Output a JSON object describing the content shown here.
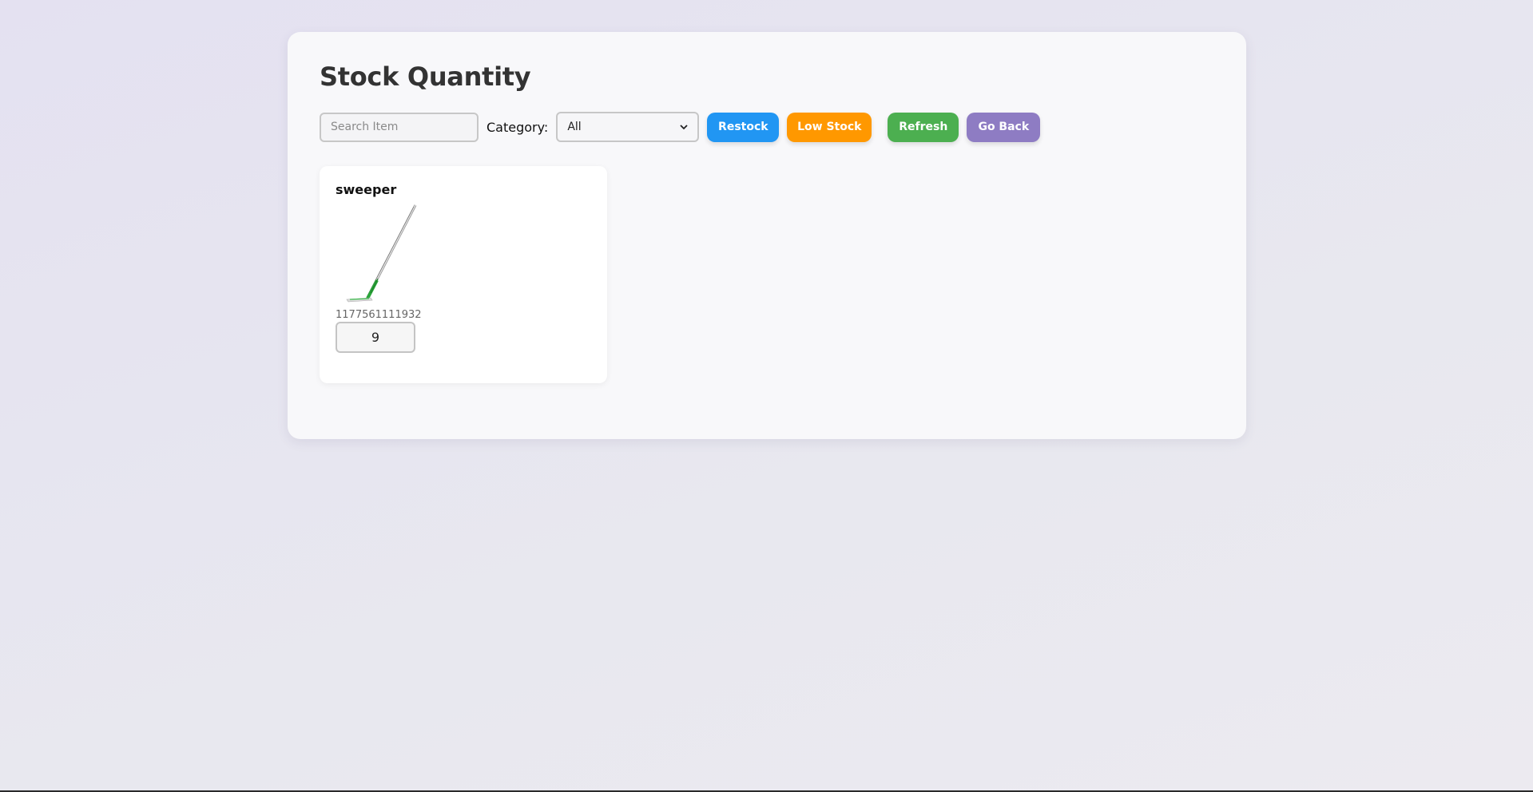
{
  "page": {
    "title": "Stock Quantity"
  },
  "toolbar": {
    "search_placeholder": "Search Item",
    "search_value": "",
    "category_label": "Category:",
    "category_selected": "All",
    "buttons": {
      "restock": "Restock",
      "low_stock": "Low Stock",
      "refresh": "Refresh",
      "go_back": "Go Back"
    }
  },
  "colors": {
    "restock": "#2196f3",
    "low_stock": "#ff9800",
    "refresh": "#4caf50",
    "go_back": "#8e7cc3"
  },
  "items": [
    {
      "name": "sweeper",
      "image_icon": "sweeper-broom-icon",
      "code": "1177561111932",
      "quantity": "9"
    }
  ]
}
